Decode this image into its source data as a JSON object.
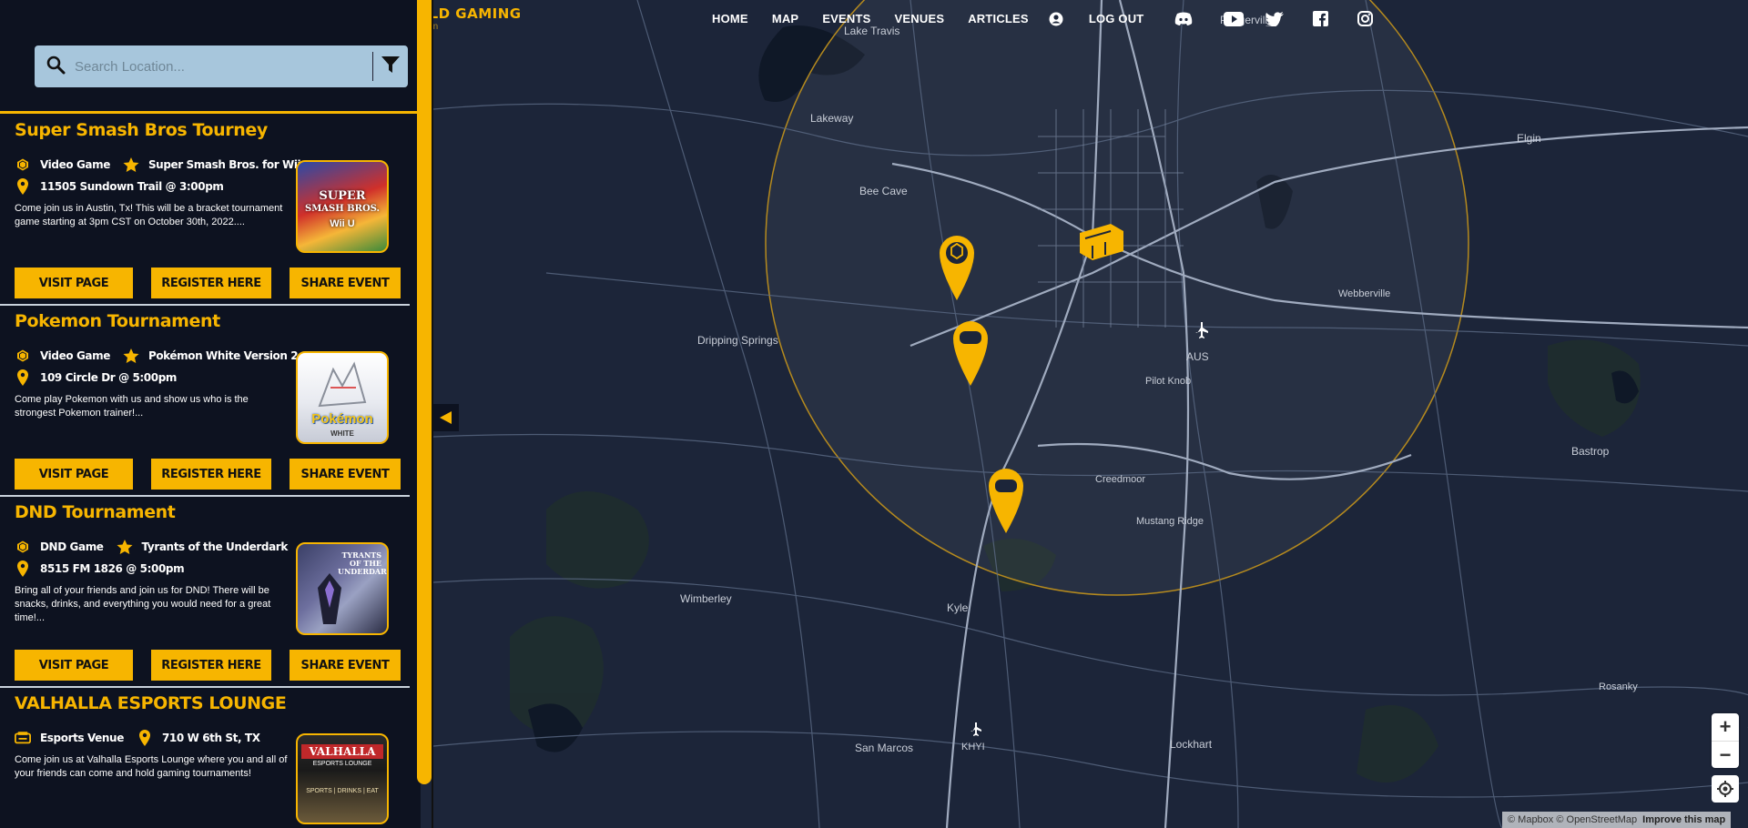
{
  "brand": {
    "name": "GUILD GAMING",
    "subtitle": "Mountain"
  },
  "nav": {
    "links": [
      "HOME",
      "MAP",
      "EVENTS",
      "VENUES",
      "ARTICLES",
      "LOG OUT"
    ]
  },
  "search": {
    "placeholder": "Search Location..."
  },
  "cards": [
    {
      "title": "Super Smash Bros Tourney",
      "type": "Video Game",
      "game": "Super Smash Bros. for Wii U",
      "location": "11505 Sundown Trail @ 3:00pm",
      "description": "Come join us in Austin, Tx! This will be a bracket tournament game starting at 3pm CST on October 30th, 2022....",
      "buttons": [
        "VISIT PAGE",
        "REGISTER HERE",
        "SHARE EVENT"
      ]
    },
    {
      "title": "Pokemon Tournament",
      "type": "Video Game",
      "game": "Pokémon White Version 2",
      "location": "109 Circle Dr @ 5:00pm",
      "description": "Come play Pokemon with us and show us who is the strongest Pokemon trainer!...",
      "buttons": [
        "VISIT PAGE",
        "REGISTER HERE",
        "SHARE EVENT"
      ]
    },
    {
      "title": "DND Tournament",
      "type": "DND Game",
      "game": "Tyrants of the Underdark",
      "location": "8515 FM 1826 @ 5:00pm",
      "description": "Bring all of your friends and join us for DND! There will be snacks, drinks, and everything you would need for a great time!...",
      "buttons": [
        "VISIT PAGE",
        "REGISTER HERE",
        "SHARE EVENT"
      ]
    },
    {
      "title": "VALHALLA ESPORTS LOUNGE",
      "type": "Esports Venue",
      "location": "710 W 6th St, TX",
      "description": "Come join us at Valhalla Esports Lounge where you and all of your friends can come and hold gaming tournaments!"
    }
  ],
  "thumbs": {
    "smash_line1": "SUPER",
    "smash_line2": "SMASH BROS.",
    "smash_line3": "Wii U",
    "pokemon": "Pokémon",
    "pokemon_sub": "WHITE",
    "tyrants": "TYRANTS OF THE UNDERDARK",
    "valhalla": "VALHALLA",
    "valhalla_sub": "ESPORTS LOUNGE",
    "valhalla_bottom": "SPORTS | DRINKS | EAT"
  },
  "map": {
    "places": [
      "Lake Travis",
      "Pflugerville",
      "Lakeway",
      "Elgin",
      "Bee Cave",
      "Webberville",
      "Dripping Springs",
      "AUS",
      "Pilot Knob",
      "Bastrop",
      "Creedmoor",
      "Mustang Ridge",
      "Wimberley",
      "Kyle",
      "Rosanky",
      "San Marcos",
      "KHYI",
      "Lockhart"
    ],
    "zoom_in": "+",
    "zoom_out": "−",
    "attribution": "© Mapbox © OpenStreetMap",
    "improve": "Improve this map"
  },
  "colors": {
    "accent": "#f7b500",
    "map_bg": "#1b2437",
    "panel": "#0d1220"
  }
}
